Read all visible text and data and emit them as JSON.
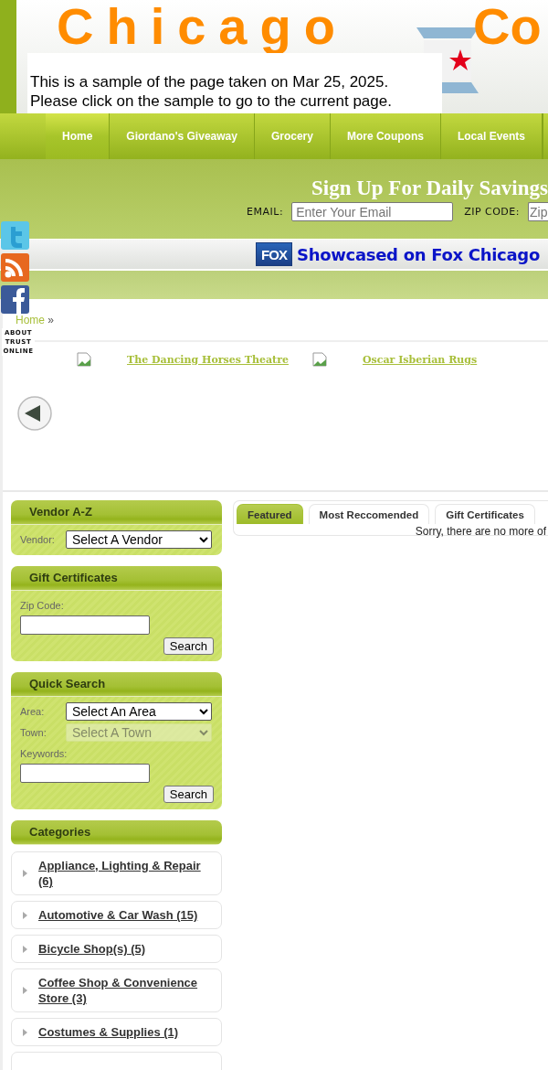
{
  "logo": {
    "word": "Chicago",
    "word_2": "Co"
  },
  "notice": {
    "lines": [
      "This is a sample of the page taken on Mar 25, 2025.",
      "Please click on the sample to go to the current page."
    ]
  },
  "nav": [
    {
      "label": "Home",
      "selected": true
    },
    {
      "label": "Giordano's Giveaway",
      "selected": false
    },
    {
      "label": "Grocery",
      "selected": false
    },
    {
      "label": "More Coupons",
      "selected": false
    },
    {
      "label": "Local Events",
      "selected": false
    }
  ],
  "signup": {
    "title": "Sign Up For Daily Savings",
    "email_label": "EMAIL:",
    "email_placeholder": "Enter Your Email",
    "zip_label": "ZIP CODE:",
    "zip_placeholder": "Zip"
  },
  "fox": {
    "badge": "FOX",
    "text": "Showcased on Fox Chicago"
  },
  "trust_badge": "ABOUT TRUST ONLINE",
  "breadcrumb": {
    "link": "Home",
    "separator": "»"
  },
  "carousel": {
    "items": [
      "The Dancing Horses Theatre",
      "Oscar Isberian Rugs"
    ]
  },
  "sidebar": {
    "vendor": {
      "title": "Vendor A-Z",
      "label": "Vendor:",
      "select": "Select A Vendor"
    },
    "gift": {
      "title": "Gift Certificates",
      "label": "Zip Code:",
      "button": "Search"
    },
    "quick": {
      "title": "Quick Search",
      "selects": [
        {
          "label": "Area:",
          "value": "Select An Area",
          "disabled": false
        },
        {
          "label": "Town:",
          "value": "Select A Town",
          "disabled": true
        }
      ],
      "keywords_label": "Keywords:",
      "button": "Search"
    },
    "categories": {
      "title": "Categories",
      "items": [
        "Appliance, Lighting & Repair (6)",
        "Automotive & Car Wash (15)",
        "Bicycle Shop(s) (5)",
        "Coffee Shop & Convenience Store (3)",
        "Costumes & Supplies (1)"
      ]
    }
  },
  "tabs": [
    {
      "label": "Featured",
      "selected": true
    },
    {
      "label": "Most Reccomended",
      "selected": false
    },
    {
      "label": "Gift Certificates",
      "selected": false
    }
  ],
  "message": "Sorry, there are no more of"
}
